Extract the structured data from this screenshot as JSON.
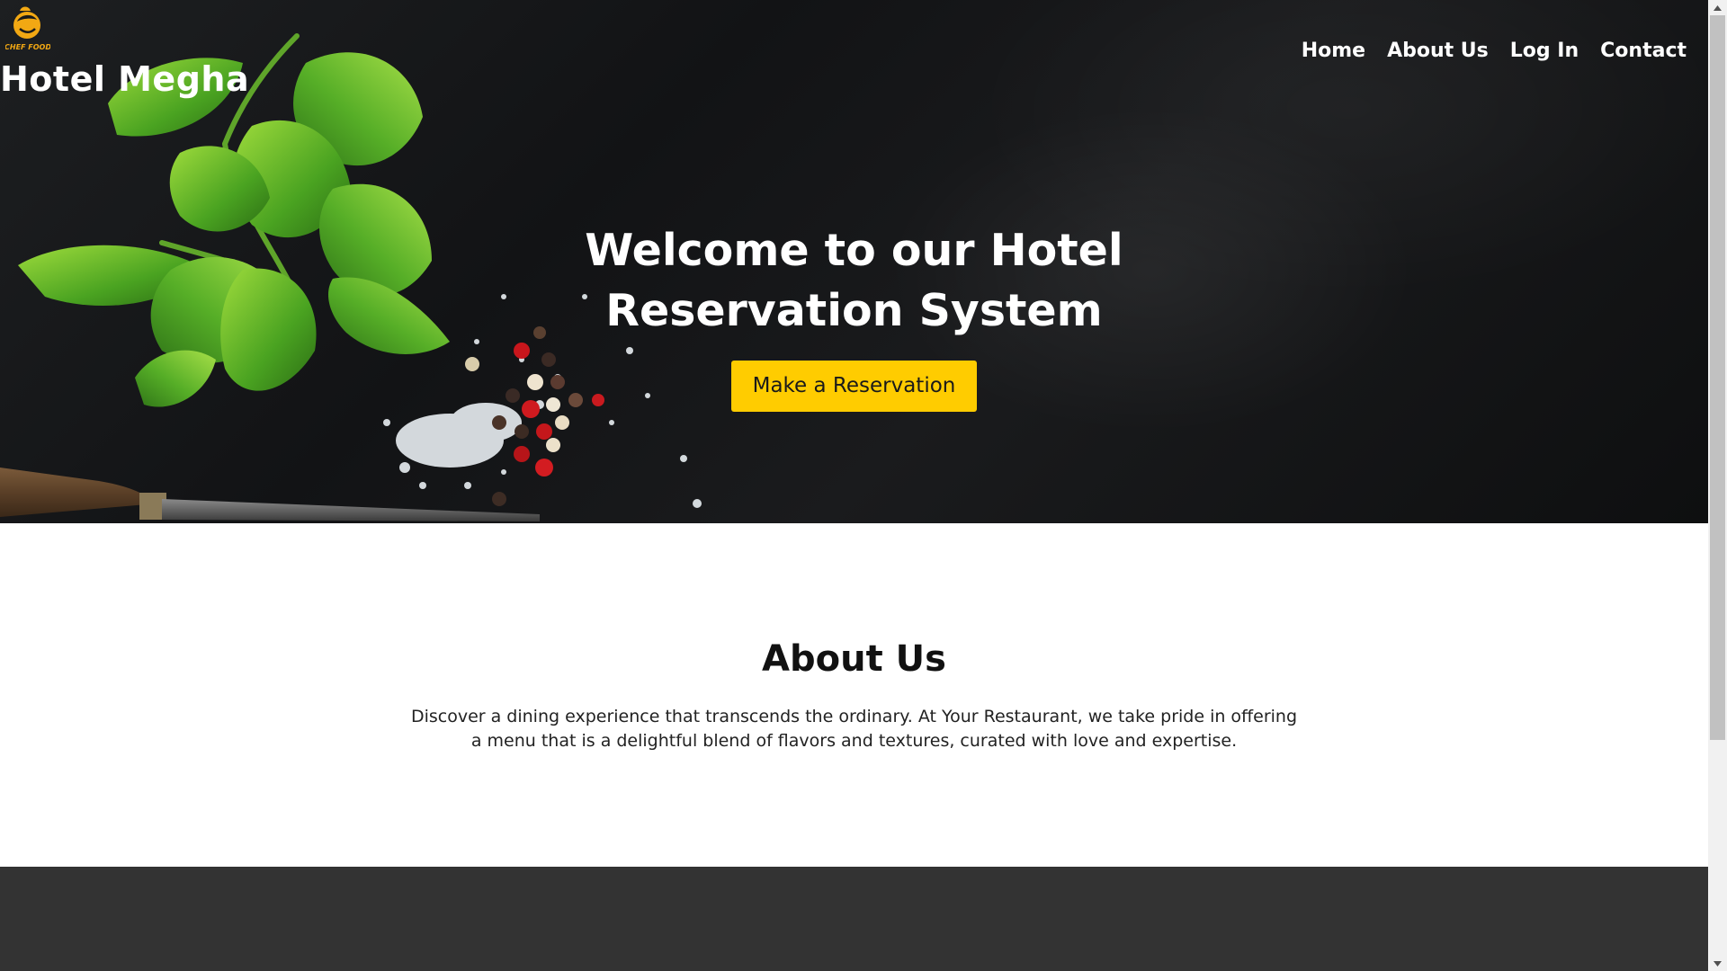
{
  "brand": {
    "logo_icon": "chef-food-logo-icon",
    "logo_text": "CHEF FOOD",
    "title": "Hotel Megha"
  },
  "nav": {
    "items": [
      {
        "label": "Home"
      },
      {
        "label": "About Us"
      },
      {
        "label": "Log In"
      },
      {
        "label": "Contact"
      }
    ]
  },
  "hero": {
    "heading": "Welcome to our Hotel Reservation System",
    "cta_label": "Make a Reservation",
    "background_image": "basil-leaves-peppercorns-salt-fork-on-dark-slate"
  },
  "about": {
    "title": "About Us",
    "text": "Discover a dining experience that transcends the ordinary. At Your Restaurant, we take pride in offering a menu that is a delightful blend of flavors and textures, curated with love and expertise."
  },
  "colors": {
    "accent": "#ffcc00",
    "hero_bg": "#151617",
    "footer_bg": "#333333",
    "text_light": "#ffffff",
    "text_dark": "#111111"
  }
}
